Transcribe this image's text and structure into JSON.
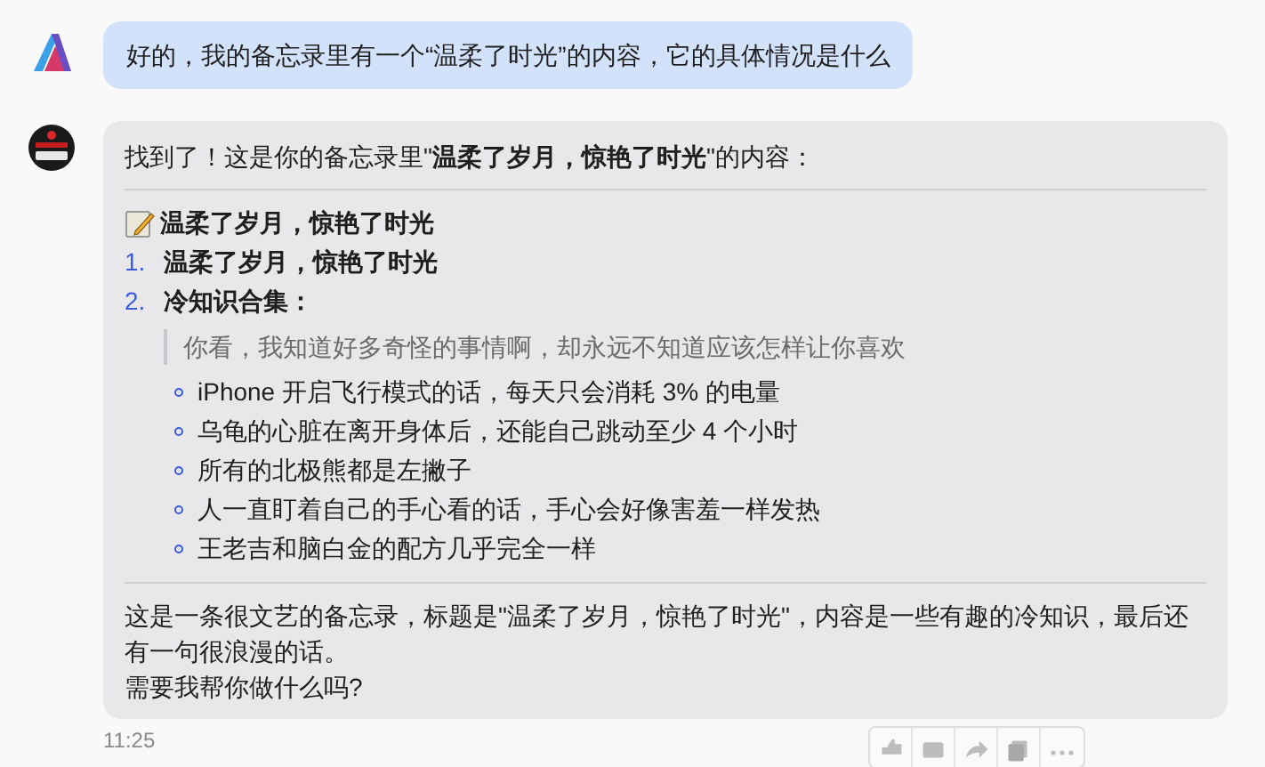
{
  "user_message": {
    "text": "好的，我的备忘录里有一个“温柔了时光”的内容，它的具体情况是什么"
  },
  "assistant_message": {
    "intro": "找到了！这是你的备忘录里\"**温柔了岁月，惊艳了时光**\"的内容：",
    "note_title": "温柔了岁月，惊艳了时光",
    "numbered_items": [
      {
        "marker": "1.",
        "text": "温柔了岁月，惊艳了时光"
      },
      {
        "marker": "2.",
        "text": "冷知识合集："
      }
    ],
    "quote": "你看，我知道好多奇怪的事情啊，却永远不知道应该怎样让你喜欢",
    "bullets": [
      "iPhone 开启飞行模式的话，每天只会消耗 3% 的电量",
      "乌龟的心脏在离开身体后，还能自己跳动至少 4 个小时",
      "所有的北极熊都是左撇子",
      "人一直盯着自己的手心看的话，手心会好像害羞一样发热",
      "王老吉和脑白金的配方几乎完全一样"
    ],
    "summary": "这是一条很文艺的备忘录，标题是\"温柔了岁月，惊艳了时光\"，内容是一些有趣的冷知识，最后还有一句很浪漫的话。",
    "question": "需要我帮你做什么吗?",
    "time": "11:25"
  }
}
